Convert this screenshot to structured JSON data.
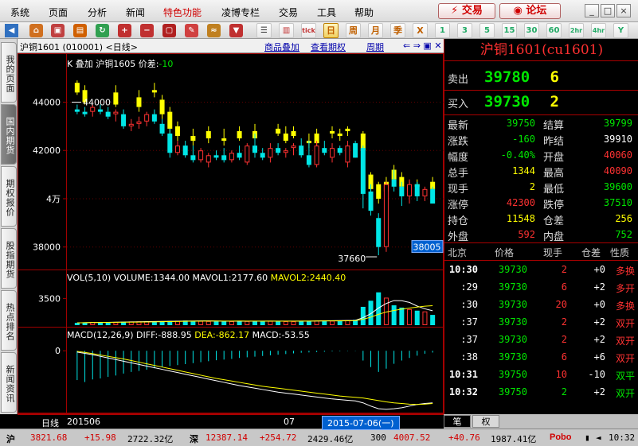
{
  "menu": [
    "系统",
    "页面",
    "分析",
    "新闻",
    "特色功能",
    "凌博专栏",
    "交易",
    "工具",
    "帮助"
  ],
  "top_buttons": {
    "trade": "交易",
    "forum": "论坛"
  },
  "window_buttons": [
    "_",
    "□",
    "×"
  ],
  "toolbar": {
    "periods": [
      "日",
      "周",
      "月",
      "季",
      "X",
      "1",
      "3",
      "5",
      "15",
      "30",
      "60",
      "2hr",
      "4hr",
      "Y"
    ],
    "tick_label": "tick"
  },
  "left_tabs": [
    "我的页面",
    "国内期货",
    "期权报价",
    "股指期货",
    "热点排名",
    "新闻资讯"
  ],
  "chart_header": {
    "title": "沪铜1601 (010001) <日线>",
    "links": [
      "商品叠加",
      "查看期权",
      "周期"
    ]
  },
  "colors": {
    "up": "#ff3232",
    "down": "#00e6e6",
    "overlay": "#ffff00",
    "bg": "#000000",
    "grid": "#a00000"
  },
  "chart_data": {
    "type": "candlestick",
    "main": {
      "overlay_text": "K 叠加 沪铜1605 价差:",
      "spread_value": "-10",
      "y_ticks": [
        "44000",
        "42000",
        "4万",
        "38000"
      ],
      "y_tick_values": [
        44000,
        42000,
        40000,
        38000
      ],
      "ylim": [
        37200,
        45300
      ],
      "annotation_high": "44000",
      "annotation_low": "37660",
      "current_price_tag": "38005",
      "candles": [
        {
          "o": 43700,
          "h": 43900,
          "l": 43500,
          "c": 43600
        },
        {
          "o": 43600,
          "h": 43800,
          "l": 43400,
          "c": 43500
        },
        {
          "o": 43600,
          "h": 43900,
          "l": 43400,
          "c": 43800
        },
        {
          "o": 43700,
          "h": 43900,
          "l": 43500,
          "c": 43600
        },
        {
          "o": 43600,
          "h": 43800,
          "l": 43300,
          "c": 43400
        },
        {
          "o": 43500,
          "h": 43700,
          "l": 43200,
          "c": 43600
        },
        {
          "o": 43500,
          "h": 43700,
          "l": 42900,
          "c": 43000
        },
        {
          "o": 43000,
          "h": 43300,
          "l": 42800,
          "c": 43100
        },
        {
          "o": 43100,
          "h": 43400,
          "l": 42900,
          "c": 43200
        },
        {
          "o": 43200,
          "h": 43600,
          "l": 43000,
          "c": 43500
        },
        {
          "o": 43500,
          "h": 43700,
          "l": 43100,
          "c": 43200
        },
        {
          "o": 43100,
          "h": 43300,
          "l": 42600,
          "c": 42700
        },
        {
          "o": 42700,
          "h": 42900,
          "l": 41700,
          "c": 41900
        },
        {
          "o": 41900,
          "h": 42400,
          "l": 41800,
          "c": 42200
        },
        {
          "o": 42200,
          "h": 42400,
          "l": 41700,
          "c": 41800
        },
        {
          "o": 41800,
          "h": 42200,
          "l": 41500,
          "c": 41600
        },
        {
          "o": 41600,
          "h": 42100,
          "l": 41500,
          "c": 42000
        },
        {
          "o": 41500,
          "h": 41900,
          "l": 41300,
          "c": 41800
        },
        {
          "o": 41800,
          "h": 42000,
          "l": 41600,
          "c": 41700
        },
        {
          "o": 41800,
          "h": 42100,
          "l": 41500,
          "c": 41600
        },
        {
          "o": 41600,
          "h": 42000,
          "l": 41500,
          "c": 41900
        },
        {
          "o": 41900,
          "h": 42200,
          "l": 41600,
          "c": 41700
        },
        {
          "o": 41500,
          "h": 42300,
          "l": 41400,
          "c": 42200
        },
        {
          "o": 42200,
          "h": 42700,
          "l": 41700,
          "c": 41900
        },
        {
          "o": 41900,
          "h": 42100,
          "l": 41600,
          "c": 41700
        },
        {
          "o": 41700,
          "h": 42300,
          "l": 41500,
          "c": 42100
        },
        {
          "o": 42100,
          "h": 42300,
          "l": 41800,
          "c": 41900
        },
        {
          "o": 41900,
          "h": 42100,
          "l": 41700,
          "c": 42000
        },
        {
          "o": 42100,
          "h": 42300,
          "l": 41800,
          "c": 42200
        },
        {
          "o": 42200,
          "h": 42500,
          "l": 41700,
          "c": 41800
        },
        {
          "o": 41800,
          "h": 42400,
          "l": 41300,
          "c": 41400
        },
        {
          "o": 41400,
          "h": 42400,
          "l": 41300,
          "c": 42200
        },
        {
          "o": 42100,
          "h": 42400,
          "l": 41800,
          "c": 41900
        },
        {
          "o": 41700,
          "h": 42300,
          "l": 41500,
          "c": 42100
        },
        {
          "o": 42100,
          "h": 42200,
          "l": 41800,
          "c": 41900
        },
        {
          "o": 41500,
          "h": 42400,
          "l": 41300,
          "c": 42200
        },
        {
          "o": 42300,
          "h": 42400,
          "l": 41700,
          "c": 41700
        },
        {
          "o": 42100,
          "h": 42200,
          "l": 39600,
          "c": 40200
        },
        {
          "o": 40300,
          "h": 40600,
          "l": 39300,
          "c": 39500
        },
        {
          "o": 39200,
          "h": 39400,
          "l": 37660,
          "c": 38000
        },
        {
          "o": 38000,
          "h": 40700,
          "l": 37800,
          "c": 40600
        },
        {
          "o": 40800,
          "h": 41200,
          "l": 40300,
          "c": 40500
        },
        {
          "o": 40500,
          "h": 40700,
          "l": 39700,
          "c": 40100
        },
        {
          "o": 40100,
          "h": 40800,
          "l": 39800,
          "c": 40600
        },
        {
          "o": 40600,
          "h": 40700,
          "l": 39900,
          "c": 40100
        },
        {
          "o": 40100,
          "h": 40500,
          "l": 39900,
          "c": 40400
        },
        {
          "o": 40400,
          "h": 40500,
          "l": 39800,
          "c": 39800
        }
      ],
      "overlay_candles": [
        {
          "o": 44800,
          "h": 44900,
          "l": 44300,
          "c": 44400
        },
        {
          "o": 44500,
          "h": 44700,
          "l": 43900,
          "c": 44000
        },
        {
          "o": 44500,
          "h": 44800,
          "l": 44300,
          "c": 44700
        },
        {
          "o": 44600,
          "h": 44800,
          "l": 44300,
          "c": 44600
        },
        {
          "o": 44200,
          "h": 44500,
          "l": 43900,
          "c": 44200
        },
        {
          "o": 44400,
          "h": 44700,
          "l": 43800,
          "c": 43900
        },
        {
          "o": 44000,
          "h": 44400,
          "l": 43700,
          "c": 44100
        },
        {
          "o": 44100,
          "h": 44400,
          "l": 43900,
          "c": 44300
        },
        {
          "o": 44200,
          "h": 44500,
          "l": 43600,
          "c": 43800
        },
        {
          "o": 44300,
          "h": 44700,
          "l": 44100,
          "c": 44600
        },
        {
          "o": 44500,
          "h": 44800,
          "l": 44200,
          "c": 44400
        },
        {
          "o": 44100,
          "h": 44300,
          "l": 43300,
          "c": 43500
        },
        {
          "o": 43600,
          "h": 43800,
          "l": 42700,
          "c": 42900
        },
        {
          "o": 43000,
          "h": 43200,
          "l": 42400,
          "c": 42600
        },
        {
          "o": 42600,
          "h": 42900,
          "l": 42400,
          "c": 42800
        },
        {
          "o": 42600,
          "h": 42900,
          "l": 42200,
          "c": 42400
        },
        {
          "o": 42400,
          "h": 42700,
          "l": 42100,
          "c": 42600
        },
        {
          "o": 42800,
          "h": 43000,
          "l": 42300,
          "c": 42500
        },
        {
          "o": 42500,
          "h": 42800,
          "l": 42300,
          "c": 42700
        },
        {
          "o": 42500,
          "h": 42900,
          "l": 42200,
          "c": 42400
        },
        {
          "o": 42500,
          "h": 42800,
          "l": 42300,
          "c": 42700
        },
        {
          "o": 42800,
          "h": 43000,
          "l": 42400,
          "c": 42500
        },
        {
          "o": 42500,
          "h": 42900,
          "l": 42300,
          "c": 42800
        },
        {
          "o": 42800,
          "h": 43100,
          "l": 42300,
          "c": 42500
        },
        {
          "o": 42500,
          "h": 42800,
          "l": 42400,
          "c": 42700
        },
        {
          "o": 42600,
          "h": 43000,
          "l": 42400,
          "c": 42900
        },
        {
          "o": 42900,
          "h": 43100,
          "l": 42600,
          "c": 42700
        },
        {
          "o": 42700,
          "h": 43000,
          "l": 42300,
          "c": 42400
        },
        {
          "o": 42800,
          "h": 43000,
          "l": 42500,
          "c": 42600
        },
        {
          "o": 42600,
          "h": 42900,
          "l": 42300,
          "c": 42800
        },
        {
          "o": 42400,
          "h": 42700,
          "l": 42100,
          "c": 42300
        },
        {
          "o": 42700,
          "h": 42900,
          "l": 42200,
          "c": 42300
        },
        {
          "o": 42300,
          "h": 42600,
          "l": 42100,
          "c": 42500
        },
        {
          "o": 42800,
          "h": 43000,
          "l": 42500,
          "c": 42700
        },
        {
          "o": 42700,
          "h": 42900,
          "l": 42400,
          "c": 42600
        },
        {
          "o": 42900,
          "h": 43000,
          "l": 42600,
          "c": 42800
        },
        {
          "o": 42600,
          "h": 42800,
          "l": 42100,
          "c": 42700
        },
        {
          "o": 42700,
          "h": 42800,
          "l": 41900,
          "c": 42000
        },
        {
          "o": 41000,
          "h": 41100,
          "l": 40200,
          "c": 40400
        },
        {
          "o": 40600,
          "h": 40700,
          "l": 39800,
          "c": 40000
        },
        {
          "o": 40700,
          "h": 40900,
          "l": 40000,
          "c": 40300
        },
        {
          "o": 41200,
          "h": 41400,
          "l": 40600,
          "c": 40800
        },
        {
          "o": 40900,
          "h": 41100,
          "l": 40300,
          "c": 40500
        },
        {
          "o": 40500,
          "h": 40700,
          "l": 40100,
          "c": 40300
        },
        {
          "o": 40600,
          "h": 40800,
          "l": 40200,
          "c": 40500
        },
        {
          "o": 40500,
          "h": 40700,
          "l": 40300,
          "c": 40600
        },
        {
          "o": 40700,
          "h": 40900,
          "l": 40100,
          "c": 40400
        }
      ]
    },
    "volume": {
      "label": "VOL(5,10)",
      "volume_text": "VOLUME:1344.00",
      "mavol1_text": "MAVOL1:2177.60",
      "mavol2_text": "MAVOL2:2440.40",
      "y_ticks": [
        "3500"
      ],
      "ylim": [
        0,
        5000
      ],
      "values": [
        300,
        350,
        400,
        380,
        420,
        390,
        450,
        480,
        500,
        520,
        460,
        500,
        550,
        580,
        600,
        520,
        560,
        540,
        500,
        480,
        520,
        560,
        540,
        500,
        520,
        560,
        540,
        520,
        500,
        560,
        580,
        600,
        620,
        580,
        600,
        640,
        700,
        2400,
        3200,
        4300,
        3600,
        2600,
        2300,
        2100,
        1900,
        1800,
        1344
      ]
    },
    "macd": {
      "label": "MACD(12,26,9)",
      "diff_text": "DIFF:-888.95",
      "dea_text": "DEA:-862.17",
      "macd_text": "MACD:-53.55",
      "y_ticks": [
        "0"
      ],
      "ylim": [
        -1900,
        250
      ],
      "hist": [
        -900,
        -960,
        -880,
        -850,
        -800,
        -760,
        -700,
        -650,
        -620,
        -580,
        -540,
        -500,
        -470,
        -440,
        -410,
        -380,
        -350,
        -320,
        -290,
        -270,
        -250,
        -220,
        -200,
        -180,
        -160,
        -140,
        -120,
        -100,
        -80,
        -60,
        -50,
        -40,
        -30,
        -20,
        -15,
        -10,
        -8,
        -300,
        -500,
        -650,
        -550,
        -400,
        -300,
        -220,
        -150,
        -90,
        -54
      ],
      "diff": [
        -40,
        -80,
        -120,
        -170,
        -220,
        -270,
        -320,
        -370,
        -420,
        -470,
        -520,
        -570,
        -620,
        -670,
        -720,
        -770,
        -820,
        -870,
        -920,
        -970,
        -1020,
        -1070,
        -1110,
        -1150,
        -1190,
        -1230,
        -1270,
        -1300,
        -1330,
        -1360,
        -1390,
        -1420,
        -1450,
        -1480,
        -1500,
        -1520,
        -1540,
        -1600,
        -1700,
        -1780,
        -1800,
        -1780,
        -1750,
        -1700,
        -1650,
        -1620,
        -1600
      ],
      "dea": [
        -20,
        -50,
        -90,
        -130,
        -170,
        -210,
        -250,
        -300,
        -350,
        -400,
        -450,
        -500,
        -550,
        -600,
        -650,
        -700,
        -750,
        -800,
        -850,
        -890,
        -930,
        -970,
        -1010,
        -1050,
        -1090,
        -1120,
        -1150,
        -1180,
        -1210,
        -1240,
        -1270,
        -1300,
        -1330,
        -1360,
        -1390,
        -1410,
        -1430,
        -1450,
        -1490,
        -1530,
        -1570,
        -1600,
        -1620,
        -1640,
        -1650,
        -1640,
        -1620
      ]
    },
    "x_labels": [
      "日线",
      "201506",
      "07"
    ],
    "cursor_date": "2015-07-06(一)"
  },
  "quote": {
    "title": "沪铜1601(cu1601)",
    "sell": {
      "label": "卖出",
      "price": "39780",
      "qty": "6"
    },
    "buy": {
      "label": "买入",
      "price": "39730",
      "qty": "2"
    },
    "fields": [
      {
        "l1": "最新",
        "v1": "39750",
        "c1": "green",
        "l2": "结算",
        "v2": "39799",
        "c2": "green"
      },
      {
        "l1": "涨跌",
        "v1": "-160",
        "c1": "green",
        "l2": "昨结",
        "v2": "39910",
        "c2": "white"
      },
      {
        "l1": "幅度",
        "v1": "-0.40%",
        "c1": "green",
        "l2": "开盘",
        "v2": "40060",
        "c2": "red"
      },
      {
        "l1": "总手",
        "v1": "1344",
        "c1": "yellow",
        "l2": "最高",
        "v2": "40090",
        "c2": "red"
      },
      {
        "l1": "现手",
        "v1": "2",
        "c1": "yellow",
        "l2": "最低",
        "v2": "39600",
        "c2": "green"
      },
      {
        "l1": "涨停",
        "v1": "42300",
        "c1": "red",
        "l2": "跌停",
        "v2": "37510",
        "c2": "green"
      },
      {
        "l1": "持仓",
        "v1": "11548",
        "c1": "yellow",
        "l2": "仓差",
        "v2": "256",
        "c2": "yellow"
      },
      {
        "l1": "外盘",
        "v1": "592",
        "c1": "red",
        "l2": "内盘",
        "v2": "752",
        "c2": "green"
      }
    ],
    "ticks_header": [
      "北京",
      "价格",
      "现手",
      "仓差",
      "性质"
    ],
    "ticks": [
      {
        "time": "10:30",
        "price": "39730",
        "qty": "2",
        "qc": "red",
        "oi": "+0",
        "nature": "多换",
        "nc": "red"
      },
      {
        "time": ":29",
        "price": "39730",
        "qty": "6",
        "qc": "red",
        "oi": "+2",
        "nature": "多开",
        "nc": "red"
      },
      {
        "time": ":30",
        "price": "39730",
        "qty": "20",
        "qc": "red",
        "oi": "+0",
        "nature": "多换",
        "nc": "red"
      },
      {
        "time": ":37",
        "price": "39730",
        "qty": "2",
        "qc": "red",
        "oi": "+2",
        "nature": "双开",
        "nc": "red"
      },
      {
        "time": ":37",
        "price": "39730",
        "qty": "2",
        "qc": "red",
        "oi": "+2",
        "nature": "双开",
        "nc": "red"
      },
      {
        "time": ":38",
        "price": "39730",
        "qty": "6",
        "qc": "red",
        "oi": "+6",
        "nature": "双开",
        "nc": "red"
      },
      {
        "time": "10:31",
        "price": "39750",
        "qty": "10",
        "qc": "red",
        "oi": "-10",
        "nature": "双平",
        "nc": "green"
      },
      {
        "time": "10:32",
        "price": "39750",
        "qty": "2",
        "qc": "green",
        "oi": "+2",
        "nature": "双开",
        "nc": "green"
      }
    ],
    "bottom_tabs": [
      "笔",
      "权"
    ]
  },
  "status": {
    "sh_label": "沪",
    "sh_index": "3821.68",
    "sh_change": "+15.98",
    "sh_amount": "2722.32亿",
    "sz_label": "深",
    "sz_index": "12387.14",
    "sz_change": "+254.72",
    "sz_amount": "2429.46亿",
    "hs_label": "300",
    "hs_index": "4007.52",
    "hs_change": "+40.76",
    "hs_amount": "1987.41亿",
    "brand": "Pobo",
    "time": "10:32"
  }
}
